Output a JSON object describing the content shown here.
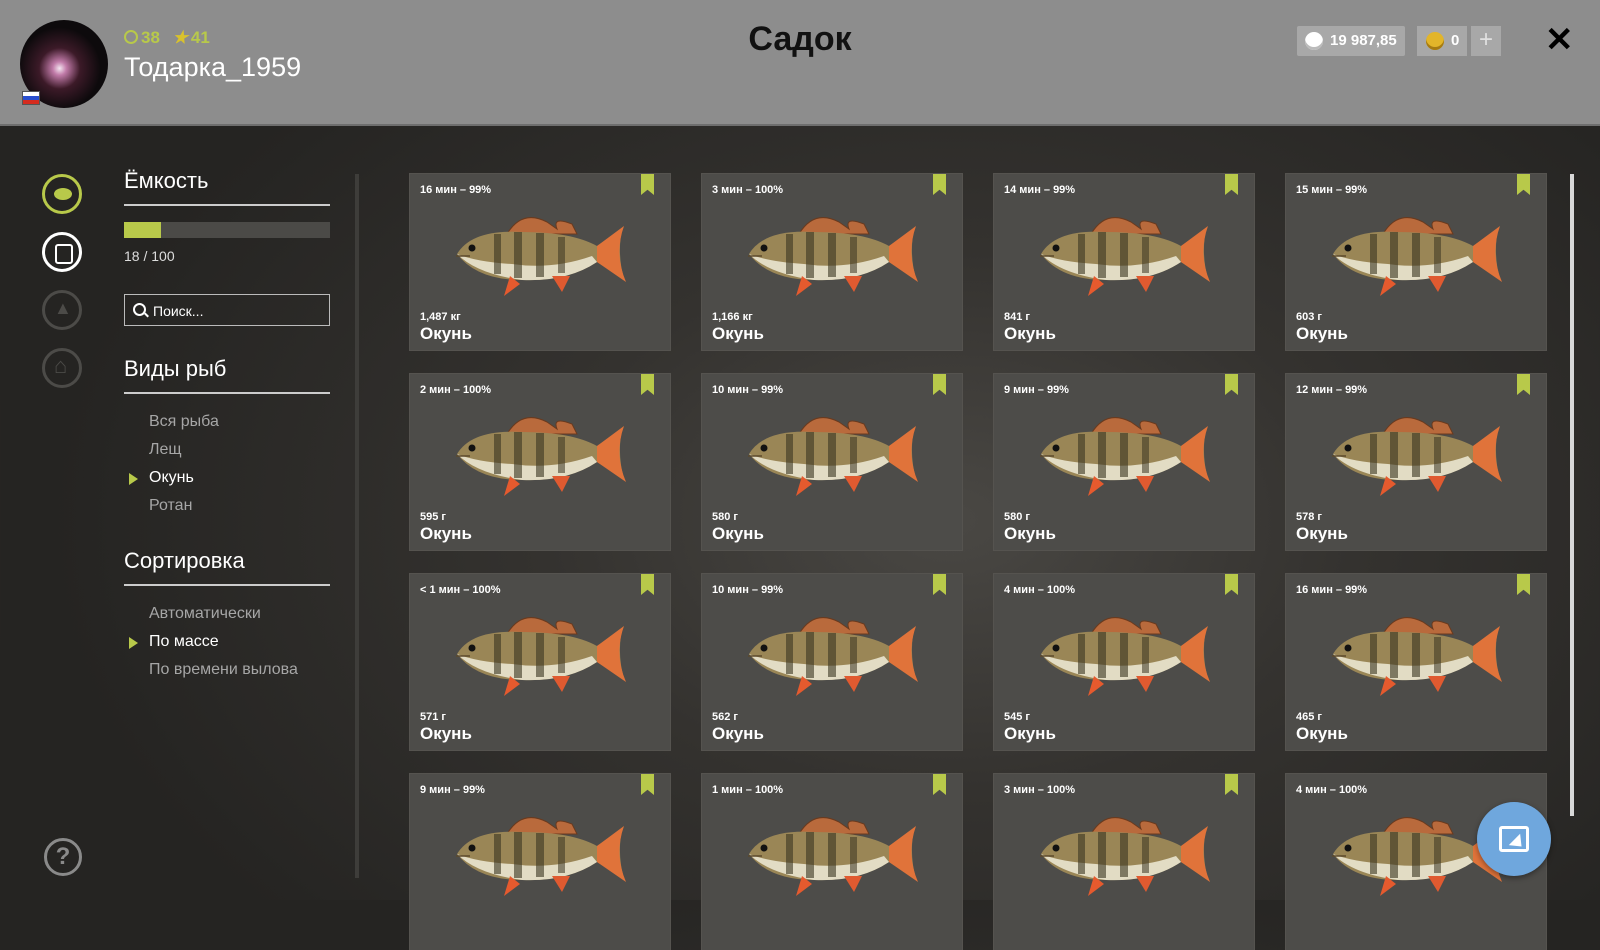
{
  "header": {
    "title": "Садок",
    "username": "Тодарка_1959",
    "level": "38",
    "rank": "41",
    "silver": "19 987,85",
    "gold": "0",
    "plus": "+",
    "close": "✕"
  },
  "panel": {
    "capacity_title": "Ёмкость",
    "capacity_text": "18 / 100",
    "capacity_fraction": 0.18,
    "search_placeholder": "Поиск...",
    "species_title": "Виды рыб",
    "species": [
      {
        "label": "Вся рыба",
        "active": false
      },
      {
        "label": "Лещ",
        "active": false
      },
      {
        "label": "Окунь",
        "active": true
      },
      {
        "label": "Ротан",
        "active": false
      }
    ],
    "sort_title": "Сортировка",
    "sort": [
      {
        "label": "Автоматически",
        "active": false
      },
      {
        "label": "По массе",
        "active": true
      },
      {
        "label": "По времени вылова",
        "active": false
      }
    ],
    "help": "?"
  },
  "fish": [
    {
      "time": "16 мин – 99%",
      "weight": "1,487 кг",
      "name": "Окунь",
      "marked": true
    },
    {
      "time": "3 мин – 100%",
      "weight": "1,166 кг",
      "name": "Окунь",
      "marked": true
    },
    {
      "time": "14 мин – 99%",
      "weight": "841 г",
      "name": "Окунь",
      "marked": true
    },
    {
      "time": "15 мин – 99%",
      "weight": "603 г",
      "name": "Окунь",
      "marked": true
    },
    {
      "time": "2 мин – 100%",
      "weight": "595 г",
      "name": "Окунь",
      "marked": true
    },
    {
      "time": "10 мин – 99%",
      "weight": "580 г",
      "name": "Окунь",
      "marked": true
    },
    {
      "time": "9 мин – 99%",
      "weight": "580 г",
      "name": "Окунь",
      "marked": true
    },
    {
      "time": "12 мин – 99%",
      "weight": "578 г",
      "name": "Окунь",
      "marked": true
    },
    {
      "time": "< 1 мин – 100%",
      "weight": "571 г",
      "name": "Окунь",
      "marked": true
    },
    {
      "time": "10 мин – 99%",
      "weight": "562 г",
      "name": "Окунь",
      "marked": true
    },
    {
      "time": "4 мин – 100%",
      "weight": "545 г",
      "name": "Окунь",
      "marked": true
    },
    {
      "time": "16 мин – 99%",
      "weight": "465 г",
      "name": "Окунь",
      "marked": true
    },
    {
      "time": "9 мин – 99%",
      "weight": "",
      "name": "",
      "marked": true
    },
    {
      "time": "1 мин – 100%",
      "weight": "",
      "name": "",
      "marked": true
    },
    {
      "time": "3 мин – 100%",
      "weight": "",
      "name": "",
      "marked": true
    },
    {
      "time": "4 мин – 100%",
      "weight": "",
      "name": "",
      "marked": false
    }
  ],
  "colors": {
    "accent": "#b8c94a",
    "header": "#8d8d8d",
    "fab": "#6fa7dd"
  },
  "icons": [
    "fish-icon",
    "backpack-icon",
    "tent-icon",
    "home-icon",
    "help-icon",
    "coin-icon",
    "gold-icon",
    "bookmark-icon",
    "pointer-icon"
  ]
}
